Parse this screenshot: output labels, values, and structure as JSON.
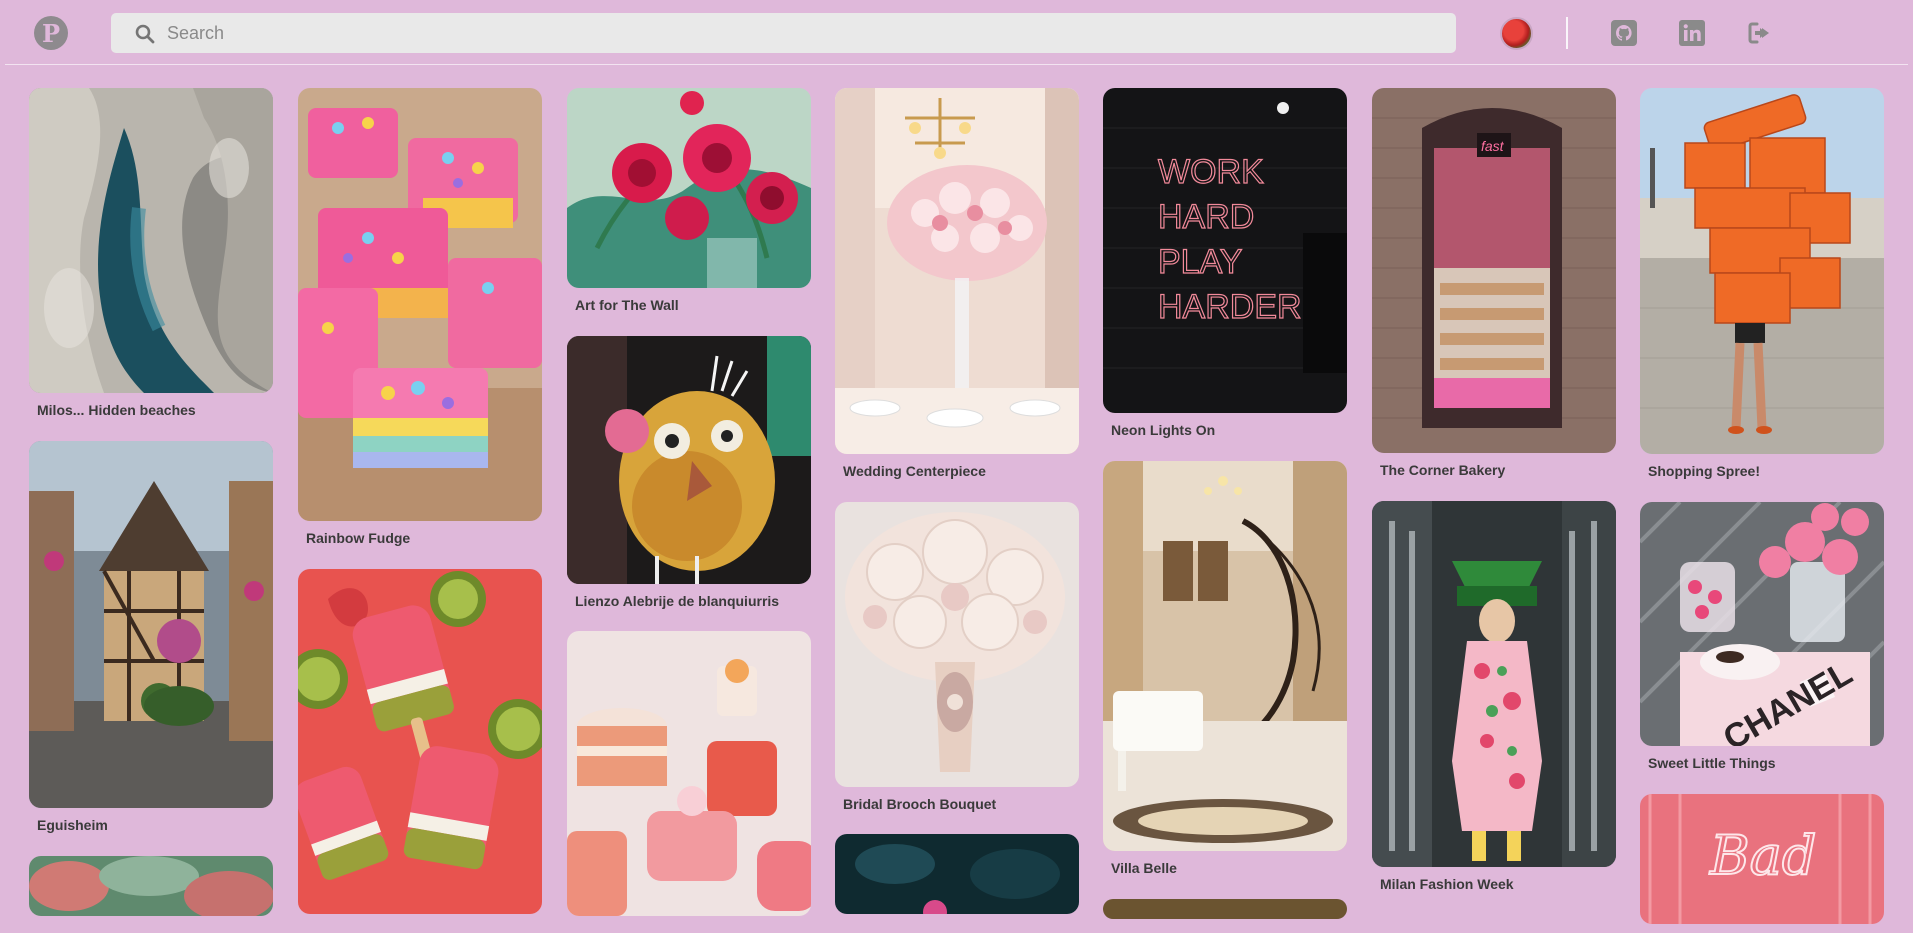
{
  "header": {
    "logo_icon": "pinterest-icon",
    "search": {
      "placeholder": "Search",
      "value": ""
    },
    "nav_icons": [
      "avatar",
      "github-icon",
      "linkedin-icon",
      "logout-icon"
    ]
  },
  "pins": [
    {
      "label": "Milos... Hidden beaches"
    },
    {
      "label": "Eguisheim"
    },
    {
      "label": ""
    },
    {
      "label": "Rainbow Fudge"
    },
    {
      "label": ""
    },
    {
      "label": "Art for The Wall"
    },
    {
      "label": "Lienzo Alebrije de blanquiurris"
    },
    {
      "label": ""
    },
    {
      "label": "Wedding Centerpiece"
    },
    {
      "label": "Bridal Brooch Bouquet"
    },
    {
      "label": ""
    },
    {
      "label": "Neon Lights On"
    },
    {
      "label": "Villa Belle"
    },
    {
      "label": ""
    },
    {
      "label": "The Corner Bakery"
    },
    {
      "label": "Milan Fashion Week"
    },
    {
      "label": "Shopping Spree!"
    },
    {
      "label": "Sweet Little Things"
    },
    {
      "label": ""
    }
  ],
  "image_text": {
    "neon": [
      "WORK",
      "HARD",
      "PLAY",
      "HARDER"
    ],
    "bakery_sign": "fast",
    "chanel": "CHANEL",
    "bad_neon": "Bad"
  }
}
